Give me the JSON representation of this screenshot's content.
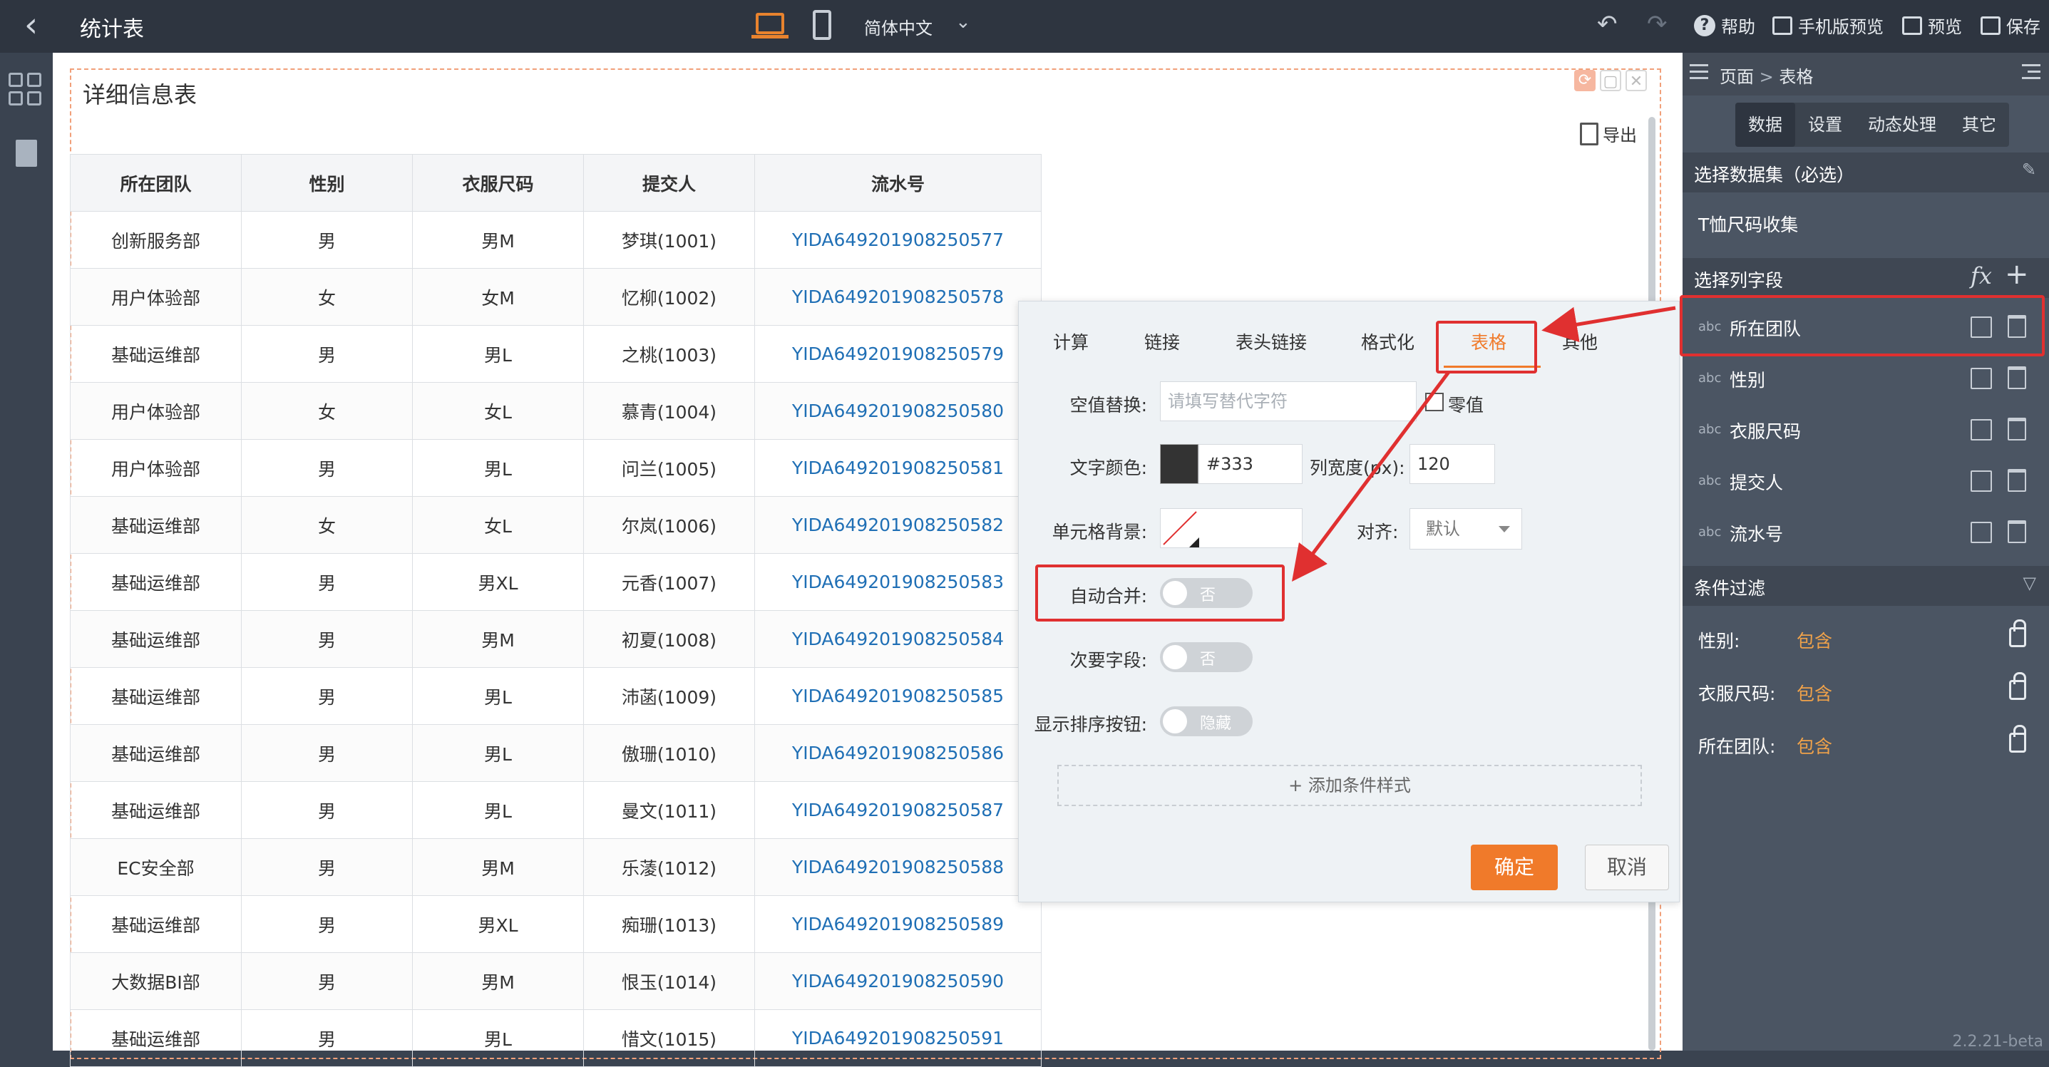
{
  "topbar": {
    "title": "统计表",
    "language": "简体中文",
    "help": "帮助",
    "mobile_preview": "手机版预览",
    "preview": "预览",
    "save": "保存"
  },
  "panel": {
    "title": "详细信息表",
    "export": "导出"
  },
  "table": {
    "headers": [
      "所在团队",
      "性别",
      "衣服尺码",
      "提交人",
      "流水号"
    ],
    "rows": [
      [
        "创新服务部",
        "男",
        "男M",
        "梦琪(1001)",
        "YIDA649201908250577"
      ],
      [
        "用户体验部",
        "女",
        "女M",
        "忆柳(1002)",
        "YIDA649201908250578"
      ],
      [
        "基础运维部",
        "男",
        "男L",
        "之桃(1003)",
        "YIDA649201908250579"
      ],
      [
        "用户体验部",
        "女",
        "女L",
        "慕青(1004)",
        "YIDA649201908250580"
      ],
      [
        "用户体验部",
        "男",
        "男L",
        "问兰(1005)",
        "YIDA649201908250581"
      ],
      [
        "基础运维部",
        "女",
        "女L",
        "尔岚(1006)",
        "YIDA649201908250582"
      ],
      [
        "基础运维部",
        "男",
        "男XL",
        "元香(1007)",
        "YIDA649201908250583"
      ],
      [
        "基础运维部",
        "男",
        "男M",
        "初夏(1008)",
        "YIDA649201908250584"
      ],
      [
        "基础运维部",
        "男",
        "男L",
        "沛菡(1009)",
        "YIDA649201908250585"
      ],
      [
        "基础运维部",
        "男",
        "男L",
        "傲珊(1010)",
        "YIDA649201908250586"
      ],
      [
        "基础运维部",
        "男",
        "男L",
        "曼文(1011)",
        "YIDA649201908250587"
      ],
      [
        "EC安全部",
        "男",
        "男M",
        "乐蓤(1012)",
        "YIDA649201908250588"
      ],
      [
        "基础运维部",
        "男",
        "男XL",
        "痴珊(1013)",
        "YIDA649201908250589"
      ],
      [
        "大数据BI部",
        "男",
        "男M",
        "恨玉(1014)",
        "YIDA649201908250590"
      ],
      [
        "基础运维部",
        "男",
        "男L",
        "惜文(1015)",
        "YIDA649201908250591"
      ]
    ]
  },
  "popup": {
    "tabs": [
      "计算",
      "链接",
      "表头链接",
      "格式化",
      "表格",
      "其他"
    ],
    "active_tab": "表格",
    "empty_replace_label": "空值替换:",
    "empty_replace_placeholder": "请填写替代字符",
    "zero_label": "零值",
    "text_color_label": "文字颜色:",
    "text_color_value": "#333",
    "col_width_label": "列宽度(px):",
    "col_width_value": "120",
    "cell_bg_label": "单元格背景:",
    "align_label": "对齐:",
    "align_value": "默认",
    "auto_merge_label": "自动合并:",
    "auto_merge_value": "否",
    "secondary_label": "次要字段:",
    "secondary_value": "否",
    "sort_btn_label": "显示排序按钮:",
    "sort_btn_value": "隐藏",
    "add_style": "+ 添加条件样式",
    "ok": "确定",
    "cancel": "取消"
  },
  "right": {
    "crumb_page": "页面",
    "crumb_sep": ">",
    "crumb_table": "表格",
    "tabs": [
      "数据",
      "设置",
      "动态处理",
      "其它"
    ],
    "dataset_section": "选择数据集（必选）",
    "dataset_name": "T恤尺码收集",
    "fields_section": "选择列字段",
    "fx": "fx",
    "plus": "+",
    "field_type": "abc",
    "fields": [
      "所在团队",
      "性别",
      "衣服尺码",
      "提交人",
      "流水号"
    ],
    "filter_section": "条件过滤",
    "filters": [
      {
        "label": "性别:",
        "value": "包含"
      },
      {
        "label": "衣服尺码:",
        "value": "包含"
      },
      {
        "label": "所在团队:",
        "value": "包含"
      }
    ],
    "version": "2.2.21-beta"
  },
  "colors": {
    "accent": "#f07a2a",
    "highlight": "#e03030",
    "link": "#1f6fb5"
  }
}
